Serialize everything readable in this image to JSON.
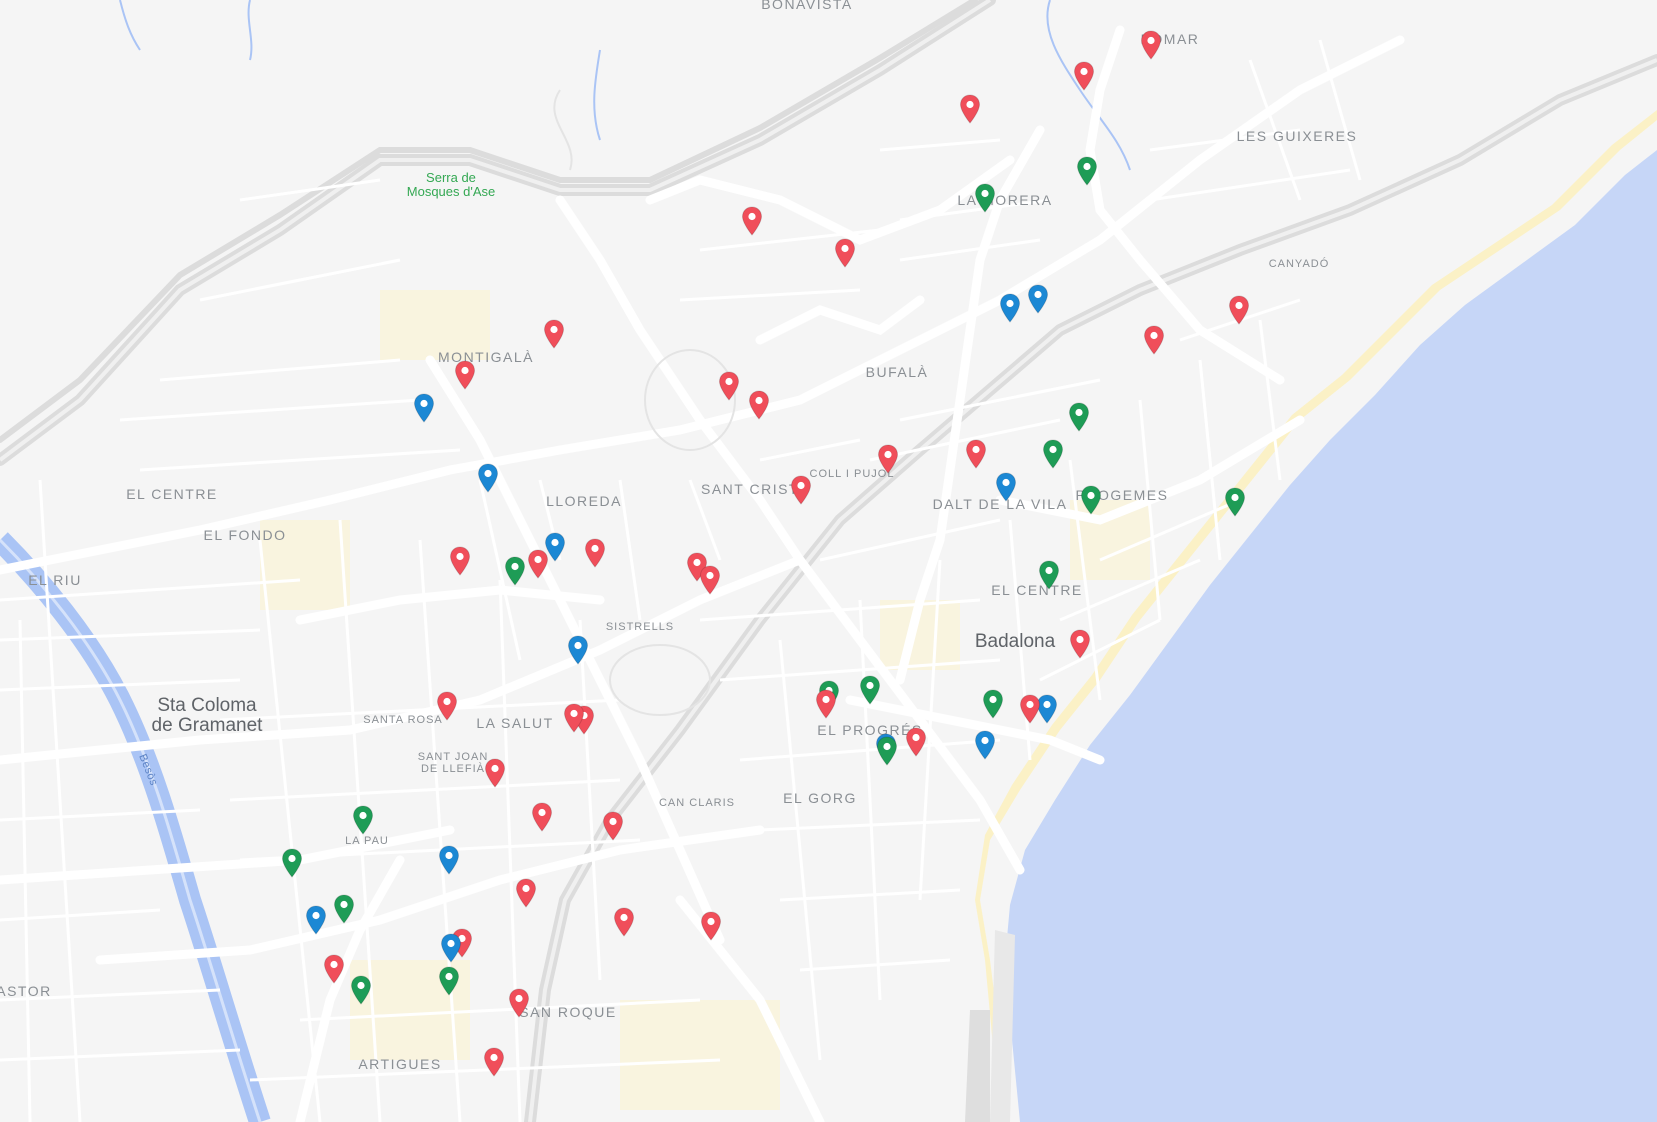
{
  "colors": {
    "red": "#f04e5a",
    "green": "#1e9c56",
    "blue": "#1c88d4",
    "sea": "#c6d6f7",
    "land": "#f5f5f5",
    "road": "#ffffff",
    "highway": "#e1e1e1",
    "beach": "#fbf1c6",
    "river": "#aac4f5"
  },
  "labels": {
    "bonavista": "BONAVISTA",
    "pomar": "POMAR",
    "les_guixeres": "LES GUIXERES",
    "serra": "Serra de\nMosques d'Ase",
    "la_morera": "LA MORERA",
    "canyado": "CANYADÓ",
    "montigala": "MONTIGALÀ",
    "bufala": "BUFALÀ",
    "coll_i_pujol": "COLL I PUJOL",
    "el_centre_w": "EL CENTRE",
    "lloreda": "LLOREDA",
    "sant_crist": "SANT CRIST",
    "dalt_de_la_vila": "DALT DE LA VILA",
    "progemes": "PROGEMES",
    "el_fondo": "EL FONDO",
    "el_riu": "EL RIU",
    "el_centre_e": "EL CENTRE",
    "sistrells": "SISTRELLS",
    "badalona": "Badalona",
    "sta_coloma": "Sta Coloma\nde Gramanet",
    "santa_rosa": "SANTA ROSA",
    "la_salut": "LA SALUT",
    "el_progres": "EL PROGRÉS",
    "sant_joan": "SANT JOAN\nDE LLEFIÀ",
    "can_claris": "CAN CLARIS",
    "el_gorg": "EL GORG",
    "la_pau": "LA PAU",
    "besos": "Besòs",
    "astor": "ASTOR",
    "san_roque": "SAN ROQUE",
    "artigues": "ARTIGUES"
  },
  "markers": [
    {
      "color": "red",
      "label": "marker"
    },
    {
      "color": "red",
      "label": "marker"
    },
    {
      "color": "red",
      "label": "marker"
    },
    {
      "color": "green",
      "label": "marker"
    },
    {
      "color": "green",
      "label": "marker"
    },
    {
      "color": "red",
      "label": "marker"
    },
    {
      "color": "red",
      "label": "marker"
    },
    {
      "color": "blue",
      "label": "marker"
    },
    {
      "color": "blue",
      "label": "marker"
    },
    {
      "color": "red",
      "label": "marker"
    },
    {
      "color": "red",
      "label": "marker"
    },
    {
      "color": "red",
      "label": "marker"
    },
    {
      "color": "red",
      "label": "marker"
    },
    {
      "color": "blue",
      "label": "marker"
    },
    {
      "color": "red",
      "label": "marker"
    },
    {
      "color": "red",
      "label": "marker"
    },
    {
      "color": "green",
      "label": "marker"
    },
    {
      "color": "red",
      "label": "marker"
    },
    {
      "color": "green",
      "label": "marker"
    },
    {
      "color": "blue",
      "label": "marker"
    },
    {
      "color": "red",
      "label": "marker"
    },
    {
      "color": "blue",
      "label": "marker"
    },
    {
      "color": "green",
      "label": "marker"
    },
    {
      "color": "green",
      "label": "marker"
    },
    {
      "color": "red",
      "label": "marker"
    },
    {
      "color": "green",
      "label": "marker"
    },
    {
      "color": "red",
      "label": "marker"
    },
    {
      "color": "blue",
      "label": "marker"
    },
    {
      "color": "red",
      "label": "marker"
    },
    {
      "color": "red",
      "label": "marker"
    },
    {
      "color": "green",
      "label": "marker"
    },
    {
      "color": "red",
      "label": "marker"
    },
    {
      "color": "red",
      "label": "marker"
    },
    {
      "color": "blue",
      "label": "marker"
    },
    {
      "color": "red",
      "label": "marker"
    },
    {
      "color": "green",
      "label": "marker"
    },
    {
      "color": "green",
      "label": "marker"
    },
    {
      "color": "red",
      "label": "marker"
    },
    {
      "color": "green",
      "label": "marker"
    },
    {
      "color": "blue",
      "label": "marker"
    },
    {
      "color": "red",
      "label": "marker"
    },
    {
      "color": "blue",
      "label": "marker"
    },
    {
      "color": "red",
      "label": "marker"
    },
    {
      "color": "blue",
      "label": "marker"
    },
    {
      "color": "green",
      "label": "marker"
    },
    {
      "color": "red",
      "label": "marker"
    },
    {
      "color": "red",
      "label": "marker"
    },
    {
      "color": "red",
      "label": "marker"
    },
    {
      "color": "red",
      "label": "marker"
    },
    {
      "color": "red",
      "label": "marker"
    },
    {
      "color": "red",
      "label": "marker"
    },
    {
      "color": "green",
      "label": "marker"
    },
    {
      "color": "green",
      "label": "marker"
    },
    {
      "color": "blue",
      "label": "marker"
    },
    {
      "color": "green",
      "label": "marker"
    },
    {
      "color": "red",
      "label": "marker"
    },
    {
      "color": "red",
      "label": "marker"
    },
    {
      "color": "blue",
      "label": "marker"
    },
    {
      "color": "red",
      "label": "marker"
    },
    {
      "color": "red",
      "label": "marker"
    },
    {
      "color": "blue",
      "label": "marker"
    },
    {
      "color": "red",
      "label": "marker"
    },
    {
      "color": "green",
      "label": "marker"
    },
    {
      "color": "green",
      "label": "marker"
    },
    {
      "color": "red",
      "label": "marker"
    },
    {
      "color": "red",
      "label": "marker"
    }
  ]
}
